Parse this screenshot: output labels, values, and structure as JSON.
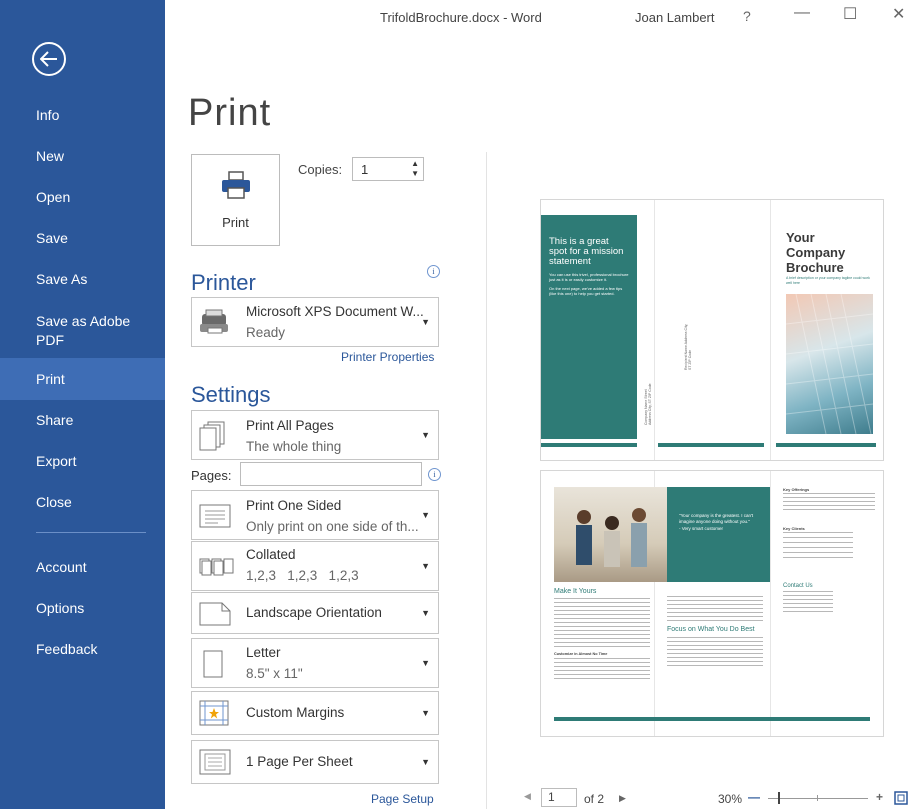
{
  "window": {
    "title": "TrifoldBrochure.docx - Word",
    "user": "Joan Lambert",
    "help": "?",
    "minimize": "—",
    "maximize": "☐",
    "close": "✕"
  },
  "sidebar": {
    "back_icon": "arrow-left",
    "items": [
      {
        "label": "Info"
      },
      {
        "label": "New"
      },
      {
        "label": "Open"
      },
      {
        "label": "Save"
      },
      {
        "label": "Save As"
      },
      {
        "label": "Save as Adobe PDF"
      },
      {
        "label": "Print"
      },
      {
        "label": "Share"
      },
      {
        "label": "Export"
      },
      {
        "label": "Close"
      },
      {
        "label": "Account"
      },
      {
        "label": "Options"
      },
      {
        "label": "Feedback"
      }
    ],
    "active": "Print",
    "colors": {
      "bg": "#2b579a",
      "active": "#3e6db5"
    }
  },
  "print": {
    "title": "Print",
    "button_label": "Print",
    "copies_label": "Copies:",
    "copies_value": "1"
  },
  "printer": {
    "heading": "Printer",
    "name": "Microsoft XPS Document W...",
    "status": "Ready",
    "properties_link": "Printer Properties"
  },
  "settings": {
    "heading": "Settings",
    "pages_label": "Pages:",
    "pages_value": "",
    "options": [
      {
        "line1": "Print All Pages",
        "line2": "The whole thing",
        "icon": "pages-icon"
      },
      {
        "line1": "Print One Sided",
        "line2": "Only print on one side of th...",
        "icon": "one-sided-icon"
      },
      {
        "line1": "Collated",
        "line2": "1,2,3   1,2,3   1,2,3",
        "icon": "collated-icon"
      },
      {
        "line1": "Landscape Orientation",
        "line2": "",
        "icon": "landscape-icon"
      },
      {
        "line1": "Letter",
        "line2": "8.5\" x 11\"",
        "icon": "paper-size-icon"
      },
      {
        "line1": "Custom Margins",
        "line2": "",
        "icon": "margins-icon"
      },
      {
        "line1": "1 Page Per Sheet",
        "line2": "",
        "icon": "pages-per-sheet-icon"
      }
    ],
    "page_setup_link": "Page Setup"
  },
  "preview": {
    "page1": {
      "mission_title": "This is a great spot for a mission statement",
      "mission_body": "You can use this trivel, professional brochure just as it is or easily customize it.",
      "mission_body2": "On the next page, we've added a few tips (like this one) to help you get started.",
      "address_vertical": "Company Name Street Address City, ST ZIP Code",
      "address_vertical2": "Recipient Name Address City, ST ZIP Code",
      "brochure_title": "Your Company Brochure",
      "brochure_sub": "A brief description or your company tagline could work well here"
    },
    "page2": {
      "quote": "\"Your company is the greatest. I can't imagine anyone doing without you.\"",
      "quote_by": "- Very smart customer",
      "make_it_yours": "Make It Yours",
      "focus": "Focus on What You Do Best",
      "key_offerings": "Key Offerings",
      "key_clients": "Key Clients",
      "contact": "Contact Us",
      "customize": "Customize in Almost No Time"
    },
    "accent": "#2e7b76"
  },
  "footer": {
    "prev_icon": "◀",
    "page_value": "1",
    "of_pages": "of 2",
    "next_icon": "▶",
    "zoom": "30%",
    "zoom_out": "—",
    "zoom_in": "+"
  }
}
